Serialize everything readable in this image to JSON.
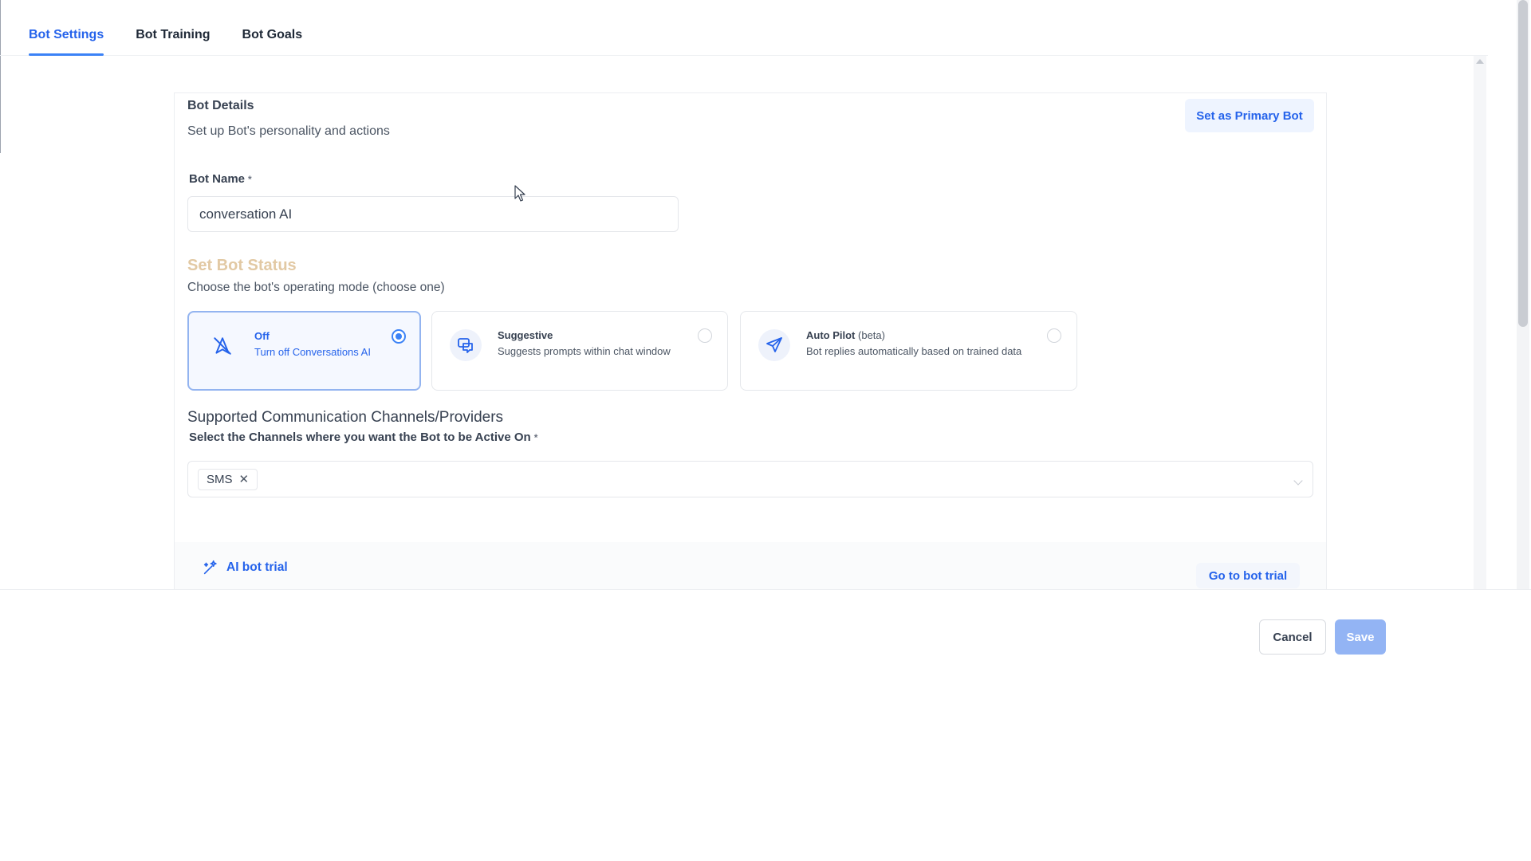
{
  "tabs": [
    {
      "label": "Bot Settings",
      "active": true
    },
    {
      "label": "Bot Training",
      "active": false
    },
    {
      "label": "Bot Goals",
      "active": false
    }
  ],
  "details": {
    "title": "Bot Details",
    "subtitle": "Set up Bot's personality and actions",
    "primary_button": "Set as Primary Bot"
  },
  "bot_name": {
    "label": "Bot Name",
    "required_mark": "*",
    "value": "conversation AI"
  },
  "status": {
    "title": "Set Bot Status",
    "subtitle": "Choose the bot's operating mode (choose one)",
    "options": [
      {
        "title": "Off",
        "desc": "Turn off Conversations AI",
        "selected": true,
        "icon": "bot-off-icon"
      },
      {
        "title": "Suggestive",
        "desc": "Suggests prompts within chat window",
        "selected": false,
        "icon": "chat-suggest-icon"
      },
      {
        "title": "Auto Pilot",
        "title_suffix": "(beta)",
        "desc": "Bot replies automatically based on trained data",
        "selected": false,
        "icon": "paper-plane-icon"
      }
    ]
  },
  "channels": {
    "title": "Supported Communication Channels/Providers",
    "subtitle": "Select the Channels where you want the Bot to be Active On",
    "required_mark": "*",
    "selected": [
      "SMS"
    ],
    "remove_glyph": "✕"
  },
  "trial": {
    "title": "AI bot trial",
    "button": "Go to bot trial"
  },
  "footer": {
    "cancel": "Cancel",
    "save": "Save"
  },
  "colors": {
    "accent": "#2563eb",
    "status_title": "#e2c9a4",
    "save_disabled": "#93b4f4"
  }
}
